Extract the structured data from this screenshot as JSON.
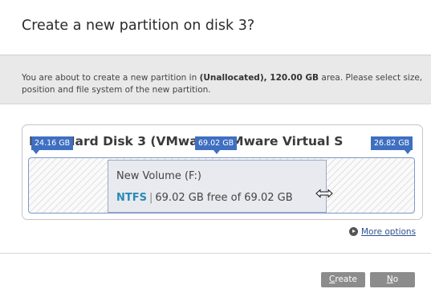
{
  "dialog": {
    "title": "Create a new partition on disk 3?",
    "info_prefix": "You are about to create a new partition in ",
    "info_bold": "(Unallocated), 120.00 GB",
    "info_suffix": " area. Please select size, position and file system of the new partition."
  },
  "disk": {
    "heading": "MBR Hard Disk 3 (VMware, VMware Virtual S",
    "left_free": "24.16 GB",
    "mid_size": "69.02 GB",
    "right_free": "26.82 GB"
  },
  "volume": {
    "name": "New Volume (F:)",
    "filesystem": "NTFS",
    "separator": "|",
    "free_text": "69.02 GB free of 69.02 GB"
  },
  "links": {
    "more_options": "More options"
  },
  "buttons": {
    "create_first": "C",
    "create_rest": "reate",
    "no_first": "N",
    "no_rest": "o"
  },
  "colors": {
    "accent": "#3f6fc1",
    "filesystem": "#2b8ab5",
    "button": "#8c8c8c",
    "info_band": "#e9e9e9"
  },
  "icons": {
    "more_options": "circle-arrow-right-icon",
    "cursor": "resize-horizontal-cursor-icon"
  }
}
